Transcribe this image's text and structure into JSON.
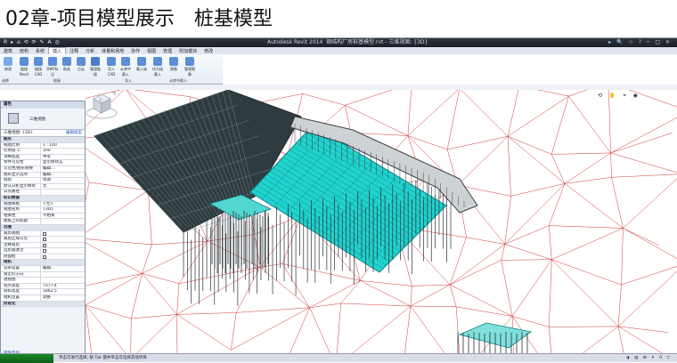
{
  "slide": {
    "title": "02章-项目模型展示　桩基模型"
  },
  "app": {
    "window_title": "Autodesk Revit 2014",
    "file_title": "钢结构厂房桩基模型.rvt - 三维视图: {3D}",
    "qat_icons": "R ▸ ⌂ ⟲ ⟳ ✎ A ◎",
    "titlebar_right": "▸ 🔍 ☆ ? ─ □ ✕",
    "tabs": [
      "建筑",
      "结构",
      "系统",
      "插入",
      "注释",
      "分析",
      "体量和场地",
      "协作",
      "视图",
      "管理",
      "附加模块",
      "修改"
    ],
    "active_tab": "插入",
    "ribbon_tools": [
      "修改",
      "链接Revit",
      "链接CAD",
      "DWF标记",
      "贴花",
      "点云",
      "管理链接",
      "导入CAD",
      "从库中载入",
      "载入族",
      "作为组载入",
      "图像",
      "管理图像"
    ],
    "ribbon_groups": [
      "选择",
      "链接",
      "导入",
      "从库中载入"
    ]
  },
  "properties": {
    "header": "属性",
    "type_name": "三维视图",
    "view_selector": "三维视图: {3D}",
    "edit_type": "编辑类型",
    "rows": [
      {
        "k": "图形",
        "v": "",
        "group": true
      },
      {
        "k": "视图比例",
        "v": "1 : 100"
      },
      {
        "k": "比例值 1:",
        "v": "100"
      },
      {
        "k": "详细程度",
        "v": "中等"
      },
      {
        "k": "零件可见性",
        "v": "显示原状态"
      },
      {
        "k": "可见性/图形替换",
        "v": "编辑..."
      },
      {
        "k": "图形显示选项",
        "v": "编辑..."
      },
      {
        "k": "规程",
        "v": "协调"
      },
      {
        "k": "默认分析显示样式",
        "v": "无"
      },
      {
        "k": "日光路径",
        "v": ""
      },
      {
        "k": "标识数据",
        "v": "",
        "group": true
      },
      {
        "k": "视图样板",
        "v": "<无>"
      },
      {
        "k": "视图名称",
        "v": "{3D}"
      },
      {
        "k": "相关性",
        "v": "不相关"
      },
      {
        "k": "图纸上的标题",
        "v": ""
      },
      {
        "k": "范围",
        "v": "",
        "group": true
      },
      {
        "k": "裁剪视图",
        "v": "",
        "check": true
      },
      {
        "k": "裁剪区域可见",
        "v": "",
        "check": true
      },
      {
        "k": "注释裁剪",
        "v": "",
        "check": true
      },
      {
        "k": "远剪裁激活",
        "v": "",
        "check": true
      },
      {
        "k": "剖面框",
        "v": "",
        "check": true
      },
      {
        "k": "相机",
        "v": "",
        "group": true
      },
      {
        "k": "渲染设置",
        "v": "编辑..."
      },
      {
        "k": "锁定的方向",
        "v": ""
      },
      {
        "k": "透视图",
        "v": ""
      },
      {
        "k": "视点高度",
        "v": "7377.4"
      },
      {
        "k": "目标高度",
        "v": "1862.5"
      },
      {
        "k": "相机位置",
        "v": "调整"
      },
      {
        "k": "阶段化",
        "v": "",
        "group": true
      }
    ],
    "help_link": "属性帮助",
    "apply": "应用"
  },
  "viewcube": {
    "face_label": "上",
    "navbar_icons": "⟲ ✋ ⌖ ◉"
  },
  "status": {
    "message": "单击可进行选择; 按 Tab 键并单击可选择其他项目",
    "scale": "1 : 100",
    "right_icons": "◑ ▤ ⊞ ✦ 0 ▽"
  },
  "colors": {
    "mesh": "#d23a3a",
    "steel_cyan": "#21d3cf",
    "dark_steel": "#1d2b2e",
    "piles": "#2a3136",
    "ribbon_blue": "#5b8ed6"
  }
}
